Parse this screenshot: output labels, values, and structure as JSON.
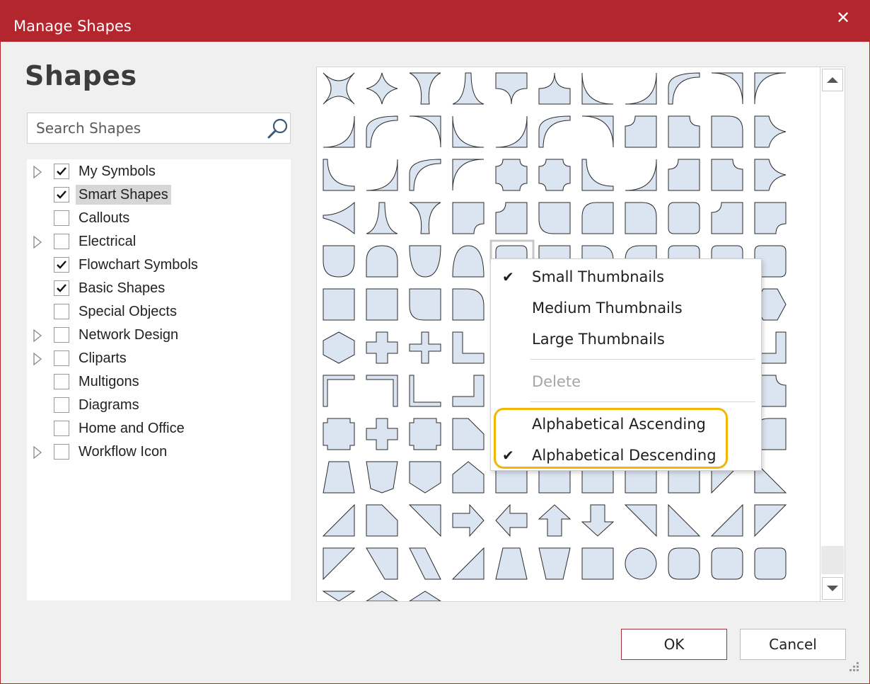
{
  "window": {
    "title": "Manage Shapes",
    "close_icon": "close-icon",
    "accent": "#b3262d"
  },
  "heading": "Shapes",
  "search": {
    "placeholder": "Search Shapes",
    "value": "",
    "icon": "search-icon"
  },
  "tree": [
    {
      "label": "My Symbols",
      "checked": true,
      "expandable": true,
      "selected": false
    },
    {
      "label": "Smart Shapes",
      "checked": true,
      "expandable": false,
      "selected": true
    },
    {
      "label": "Callouts",
      "checked": false,
      "expandable": false,
      "selected": false
    },
    {
      "label": "Electrical",
      "checked": false,
      "expandable": true,
      "selected": false
    },
    {
      "label": "Flowchart Symbols",
      "checked": true,
      "expandable": false,
      "selected": false
    },
    {
      "label": "Basic Shapes",
      "checked": true,
      "expandable": false,
      "selected": false
    },
    {
      "label": "Special Objects",
      "checked": false,
      "expandable": false,
      "selected": false
    },
    {
      "label": "Network Design",
      "checked": false,
      "expandable": true,
      "selected": false
    },
    {
      "label": "Cliparts",
      "checked": false,
      "expandable": true,
      "selected": false
    },
    {
      "label": "Multigons",
      "checked": false,
      "expandable": false,
      "selected": false
    },
    {
      "label": "Diagrams",
      "checked": false,
      "expandable": false,
      "selected": false
    },
    {
      "label": "Home and Office",
      "checked": false,
      "expandable": false,
      "selected": false
    },
    {
      "label": "Workflow Icon",
      "checked": false,
      "expandable": true,
      "selected": false
    }
  ],
  "context_menu": {
    "items": [
      {
        "label": "Small Thumbnails",
        "checked": true,
        "disabled": false
      },
      {
        "label": "Medium Thumbnails",
        "checked": false,
        "disabled": false
      },
      {
        "label": "Large Thumbnails",
        "checked": false,
        "disabled": false
      },
      {
        "label": "Delete",
        "checked": false,
        "disabled": true
      },
      {
        "label": "Alphabetical Ascending",
        "checked": false,
        "disabled": false
      },
      {
        "label": "Alphabetical Descending",
        "checked": true,
        "disabled": false
      }
    ],
    "highlight_color": "#f2b705"
  },
  "buttons": {
    "ok": "OK",
    "cancel": "Cancel"
  },
  "shape_fill": "#dbe4f1",
  "shape_stroke": "#2b2b2b"
}
